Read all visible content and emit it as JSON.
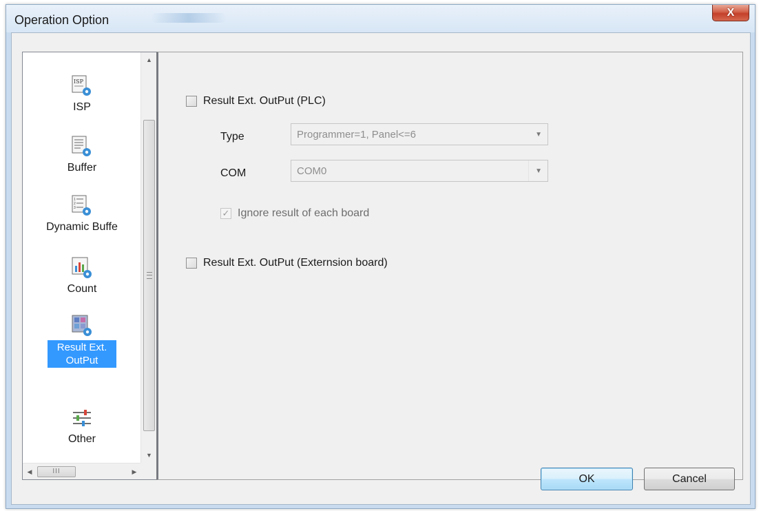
{
  "window": {
    "title": "Operation Option",
    "close_label": "X"
  },
  "nav": {
    "items": [
      {
        "label": "ISP",
        "icon": "isp-gear-icon"
      },
      {
        "label": "Buffer",
        "icon": "buffer-gear-icon"
      },
      {
        "label": "Dynamic Buffe",
        "icon": "dynamic-buffer-gear-icon"
      },
      {
        "label": "Count",
        "icon": "count-chart-gear-icon"
      },
      {
        "label_line1": "Result Ext.",
        "label_line2": "OutPut",
        "icon": "result-output-gear-icon",
        "selected": true
      },
      {
        "label": "Other",
        "icon": "sliders-icon"
      }
    ],
    "hscroll_thumb": "III"
  },
  "panel": {
    "plc_checkbox_label": "Result Ext. OutPut (PLC)",
    "plc_checked": false,
    "type_label": "Type",
    "type_value": "Programmer=1, Panel<=6",
    "com_label": "COM",
    "com_value": "COM0",
    "ignore_label": "Ignore result of each board",
    "ignore_checked": true,
    "ext_checkbox_label": "Result Ext. OutPut (Externsion board)",
    "ext_checked": false
  },
  "buttons": {
    "ok": "OK",
    "cancel": "Cancel"
  },
  "colors": {
    "selection": "#3399ff",
    "close_button": "#c4402a"
  }
}
